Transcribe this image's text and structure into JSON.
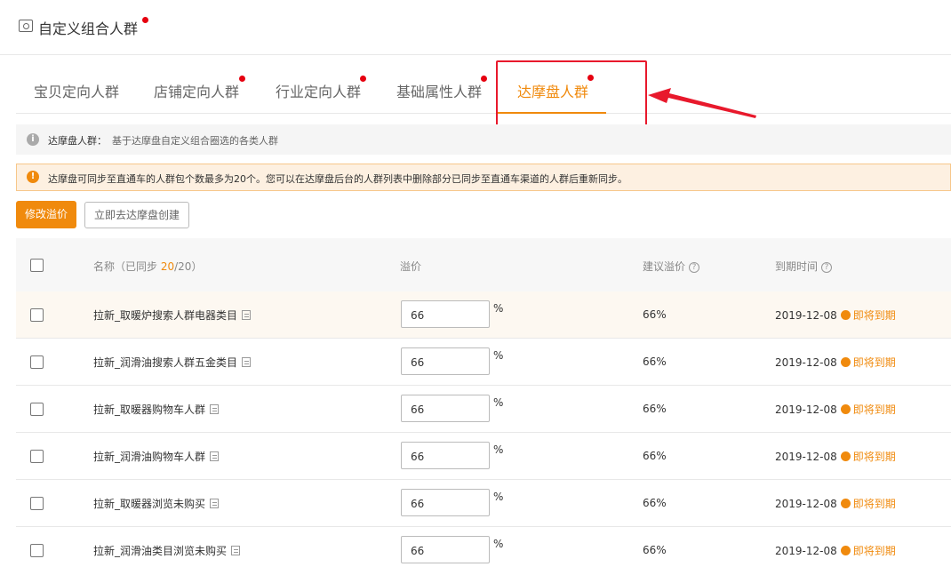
{
  "header": {
    "title": "自定义组合人群"
  },
  "tabs": [
    {
      "label": "宝贝定向人群"
    },
    {
      "label": "店铺定向人群"
    },
    {
      "label": "行业定向人群"
    },
    {
      "label": "基础属性人群"
    },
    {
      "label": "达摩盘人群"
    }
  ],
  "info": {
    "label": "达摩盘人群：",
    "desc": "基于达摩盘自定义组合圈选的各类人群"
  },
  "warning": {
    "text": "达摩盘可同步至直通车的人群包个数最多为20个。您可以在达摩盘后台的人群列表中删除部分已同步至直通车渠道的人群后重新同步。"
  },
  "actions": {
    "modify_premium": "修改溢价",
    "go_create": "立即去达摩盘创建"
  },
  "table": {
    "col_name": "名称",
    "synced_prefix": "（已同步 ",
    "synced_count": "20",
    "synced_total": "/20）",
    "col_premium": "溢价",
    "col_suggest": "建议溢价",
    "col_expire": "到期时间",
    "rows": [
      {
        "name": "拉新_取暖炉搜索人群电器类目",
        "premium": "66",
        "unit": "%",
        "suggest": "66%",
        "date": "2019-12-08",
        "status": "即将到期"
      },
      {
        "name": "拉新_润滑油搜索人群五金类目",
        "premium": "66",
        "unit": "%",
        "suggest": "66%",
        "date": "2019-12-08",
        "status": "即将到期"
      },
      {
        "name": "拉新_取暖器购物车人群",
        "premium": "66",
        "unit": "%",
        "suggest": "66%",
        "date": "2019-12-08",
        "status": "即将到期"
      },
      {
        "name": "拉新_润滑油购物车人群",
        "premium": "66",
        "unit": "%",
        "suggest": "66%",
        "date": "2019-12-08",
        "status": "即将到期"
      },
      {
        "name": "拉新_取暖器浏览未购买",
        "premium": "66",
        "unit": "%",
        "suggest": "66%",
        "date": "2019-12-08",
        "status": "即将到期"
      },
      {
        "name": "拉新_润滑油类目浏览未购买",
        "premium": "66",
        "unit": "%",
        "suggest": "66%",
        "date": "2019-12-08",
        "status": "即将到期"
      }
    ]
  },
  "colors": {
    "accent": "#f08a0d",
    "red_dot": "#e6000f",
    "annotation": "#e8192c"
  }
}
